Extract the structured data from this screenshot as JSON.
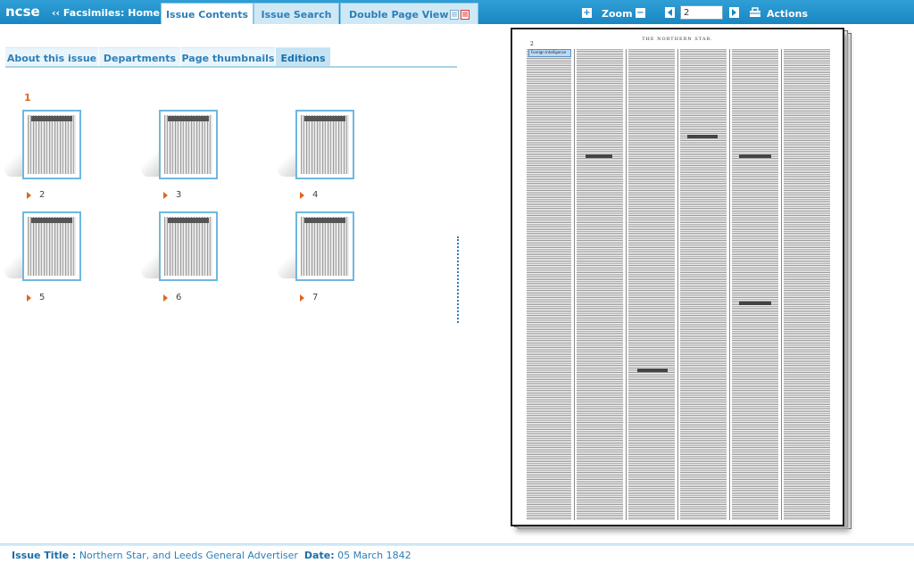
{
  "header": {
    "logo": "ncse",
    "home_link": "‹‹ Facsimiles: Home",
    "tabs": [
      {
        "label": "Issue Contents"
      },
      {
        "label": "Issue Search"
      },
      {
        "label": "Double Page View"
      }
    ],
    "zoom_label": "Zoom",
    "page_value": "2",
    "actions_label": "Actions"
  },
  "subtabs": [
    {
      "label": "About this issue"
    },
    {
      "label": "Departments"
    },
    {
      "label": "Page thumbnails"
    },
    {
      "label": "Editions"
    }
  ],
  "edition": {
    "number": "1",
    "pages": [
      "2",
      "3",
      "4",
      "5",
      "6",
      "7"
    ]
  },
  "newspaper": {
    "page_number": "2",
    "masthead": "THE NORTHERN STAR.",
    "highlight_text": "Foreign Intelligence"
  },
  "footer": {
    "title_label": "Issue Title :",
    "title_value": "Northern Star, and Leeds General Advertiser",
    "date_label": "Date:",
    "date_value": "05 March 1842"
  },
  "colors": {
    "topbar": "#1a86c2",
    "accent": "#2d7fb8",
    "highlight": "#e0661a"
  }
}
